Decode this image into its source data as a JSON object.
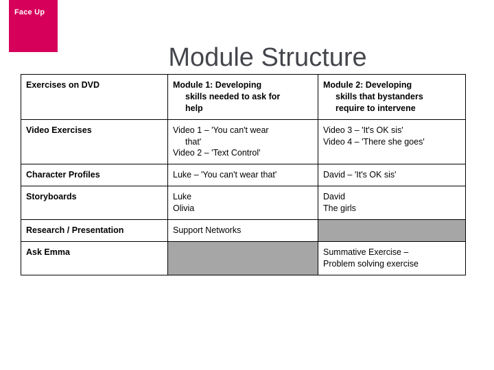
{
  "logo": {
    "text": "Face Up",
    "color": "#d6005a",
    "text_color": "#ffffff"
  },
  "title": {
    "text": "Module Structure",
    "color": "#44464c"
  },
  "colors": {
    "shaded_cell": "#a6a6a6",
    "border": "#000000",
    "cell_background": "#ffffff"
  },
  "table": {
    "columns": [
      {
        "key": "label",
        "header": "Exercises on DVD"
      },
      {
        "key": "module1",
        "header_line1": "Module 1: Developing",
        "header_line2": "skills needed to ask for",
        "header_line3": "help",
        "header": "Module 1: Developing skills needed to ask for help"
      },
      {
        "key": "module2",
        "header_line1": "Module 2: Developing",
        "header_line2": "skills that bystanders",
        "header_line3": "require to intervene",
        "header": "Module 2: Developing skills that bystanders require to intervene"
      }
    ],
    "rows": [
      {
        "label": "Video Exercises",
        "module1_line1": "Video 1 – 'You can't wear",
        "module1_line2": "that'",
        "module1_line3": "Video 2 – 'Text Control'",
        "module2_line1": "Video 3 – 'It's OK sis'",
        "module2_line2": "Video 4 – 'There she goes'",
        "module1_shaded": false,
        "module2_shaded": false
      },
      {
        "label": "Character Profiles",
        "module1_line1": "Luke – 'You can't wear that'",
        "module1_line2": "",
        "module1_line3": "",
        "module2_line1": "David – 'It's OK sis'",
        "module2_line2": "",
        "module1_shaded": false,
        "module2_shaded": false
      },
      {
        "label": "Storyboards",
        "module1_line1": "Luke",
        "module1_line2": "Olivia",
        "module1_line3": "",
        "module2_line1": "David",
        "module2_line2": "The girls",
        "module1_shaded": false,
        "module2_shaded": false
      },
      {
        "label": "Research / Presentation",
        "module1_line1": "Support Networks",
        "module1_line2": "",
        "module1_line3": "",
        "module2_line1": "",
        "module2_line2": "",
        "module1_shaded": false,
        "module2_shaded": true
      },
      {
        "label": "Ask Emma",
        "module1_line1": "",
        "module1_line2": "",
        "module1_line3": "",
        "module2_line1": "Summative Exercise –",
        "module2_line2": "Problem solving exercise",
        "module1_shaded": true,
        "module2_shaded": false
      }
    ]
  }
}
